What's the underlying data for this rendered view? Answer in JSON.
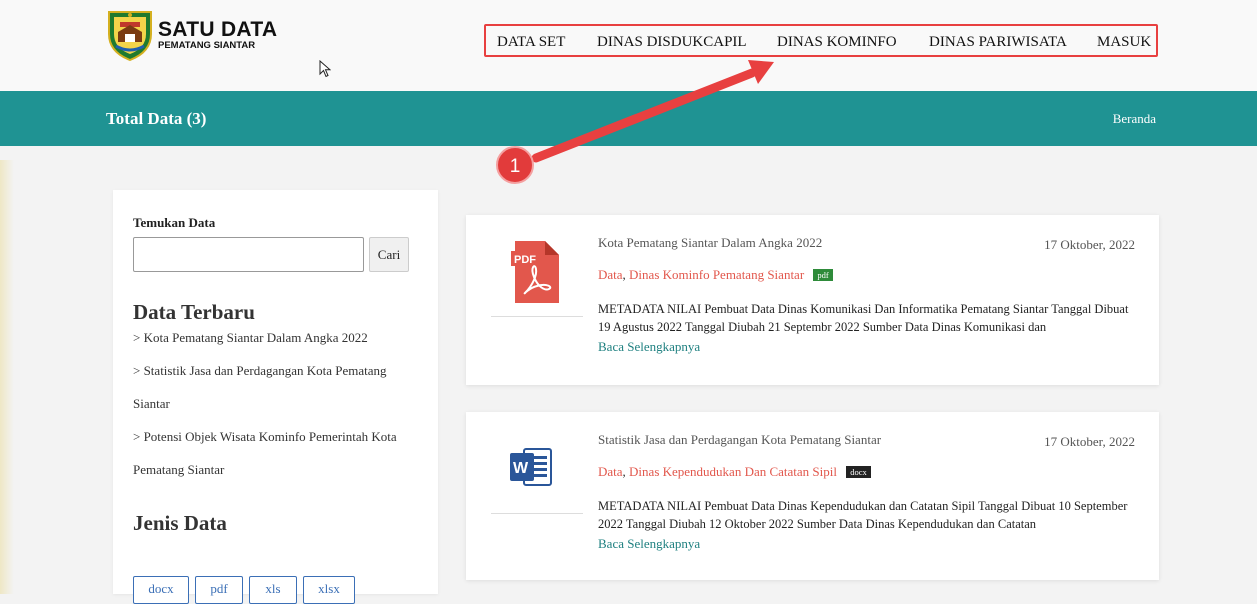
{
  "header": {
    "logo_title": "SATU DATA",
    "logo_subtitle": "PEMATANG SIANTAR",
    "nav": [
      {
        "label": "DATA SET"
      },
      {
        "label": "DINAS DISDUKCAPIL"
      },
      {
        "label": "DINAS KOMINFO"
      },
      {
        "label": "DINAS PARIWISATA"
      },
      {
        "label": "MASUK"
      }
    ]
  },
  "banner": {
    "title": "Total Data (3)",
    "home_link": "Beranda"
  },
  "sidebar": {
    "find_label": "Temukan Data",
    "search_placeholder": "",
    "search_button": "Cari",
    "latest_title": "Data Terbaru",
    "latest_lines": [
      "> Kota Pematang Siantar Dalam Angka 2022",
      "> Statistik Jasa dan Perdagangan Kota Pematang",
      "Siantar",
      "> Potensi Objek Wisata Kominfo Pemerintah Kota",
      "Pematang Siantar"
    ],
    "types_title": "Jenis Data",
    "types": [
      "docx",
      "pdf",
      "xls",
      "xlsx"
    ]
  },
  "datasets": [
    {
      "title": "Kota Pematang Siantar Dalam Angka 2022",
      "date": "17 Oktober, 2022",
      "category": "Data",
      "separator": ",",
      "agency": "Dinas Kominfo Pematang Siantar",
      "format": "pdf",
      "description": "METADATA NILAI Pembuat Data Dinas Komunikasi Dan Informatika Pematang Siantar Tanggal Dibuat 19 Agustus 2022 Tanggal Diubah 21 Septembr 2022 Sumber Data Dinas Komunikasi dan",
      "read_more": "Baca Selengkapnya",
      "icon": "pdf-file-icon",
      "icon_label": "PDF"
    },
    {
      "title": "Statistik Jasa dan Perdagangan Kota Pematang Siantar",
      "date": "17 Oktober, 2022",
      "category": "Data",
      "separator": ",",
      "agency": "Dinas Kependudukan Dan Catatan Sipil",
      "format": "docx",
      "description": "METADATA NILAI Pembuat Data Dinas Kependudukan dan Catatan Sipil Tanggal Dibuat 10 September 2022 Tanggal Diubah 12 Oktober 2022 Sumber Data Dinas Kependudukan dan Catatan",
      "read_more": "Baca Selengkapnya",
      "icon": "word-file-icon",
      "icon_label": "W"
    }
  ],
  "annotation": {
    "step_number": "1"
  },
  "colors": {
    "banner": "#1f9393",
    "nav_highlight": "#e84040",
    "link_red": "#e2574c",
    "read_more": "#1f8080",
    "pdf_badge": "#2e8b3a",
    "docx_badge": "#222222",
    "type_button": "#3b6fb6"
  }
}
